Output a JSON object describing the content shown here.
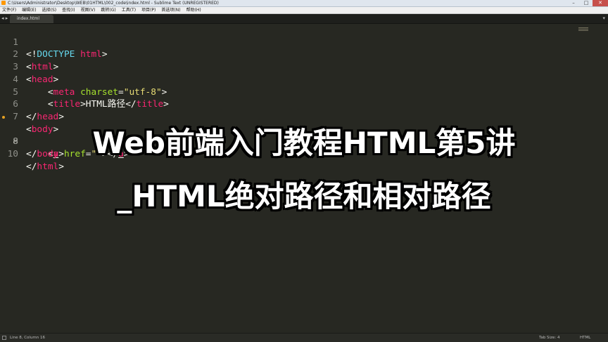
{
  "window": {
    "title": "C:\\Users\\Administrator\\Desktop\\WEB\\01HTML\\002_code\\index.html - Sublime Text (UNREGISTERED)",
    "minimize": "–",
    "maximize": "□",
    "close": "✕"
  },
  "menu": [
    "文件(F)",
    "编辑(E)",
    "选择(S)",
    "查找(I)",
    "视图(V)",
    "跳转(G)",
    "工具(T)",
    "项目(P)",
    "首选项(N)",
    "帮助(H)"
  ],
  "tabs": {
    "active": "index.html",
    "nav_arrows": "◂ ▸",
    "dropdown": "▾"
  },
  "editor": {
    "line_numbers": [
      "1",
      "2",
      "3",
      "4",
      "5",
      "6",
      "7",
      "8",
      "9",
      "10"
    ],
    "lines": {
      "l1": {
        "lt": "<!",
        "doctype": "DOCTYPE",
        "html": " html",
        "gt": ">"
      },
      "l2": {
        "lt": "<",
        "tag": "html",
        "gt": ">"
      },
      "l3": {
        "lt": "<",
        "tag": "head",
        "gt": ">"
      },
      "l4": {
        "indent": "    ",
        "lt": "<",
        "tag": "meta",
        "attr": " charset",
        "eq": "=",
        "val": "\"utf-8\"",
        "gt": ">"
      },
      "l5": {
        "indent": "    ",
        "lt": "<",
        "tag": "title",
        "gt": ">",
        "text": "HTML路径",
        "lt2": "</",
        "tag2": "title",
        "gt2": ">"
      },
      "l6": {
        "lt": "</",
        "tag": "head",
        "gt": ">"
      },
      "l7": {
        "lt": "<",
        "tag": "body",
        "gt": ">"
      },
      "l8": {
        "indent": "    ",
        "lt": "<",
        "tag": "a",
        "attr": " href",
        "eq": "=",
        "val": "\"\"",
        "gt": ">",
        "lt2": "</",
        "tag2": "a",
        "gt2": ">"
      },
      "l9": {
        "lt": "</",
        "tag": "body",
        "gt": ">"
      },
      "l10": {
        "lt": "</",
        "tag": "html",
        "gt": ">"
      }
    }
  },
  "overlay": {
    "line1": "Web前端入门教程HTML第5讲",
    "line2": "_HTML绝对路径和相对路径"
  },
  "status": {
    "position": "Line 8, Column 16",
    "tab_size": "Tab Size: 4",
    "syntax": "HTML"
  },
  "colors": {
    "background": "#272822",
    "tag": "#f92672",
    "attribute": "#a6e22e",
    "string": "#e6db74",
    "keyword": "#66d9ef",
    "text": "#f8f8f2",
    "line_number": "#8f908a"
  }
}
